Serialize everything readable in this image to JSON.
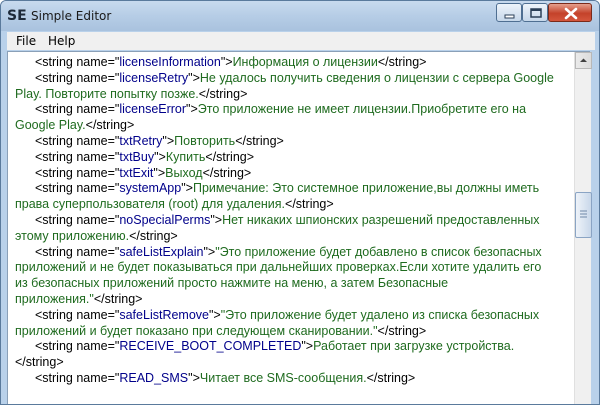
{
  "window": {
    "icon_text": "SE",
    "title": "Simple Editor"
  },
  "menu": {
    "file": "File",
    "help": "Help"
  },
  "editor": {
    "lines": [
      {
        "indent": true,
        "pre": "<string name=\"",
        "key": "licenseInformation",
        "mid": "\">",
        "val": "Информация о лицензии",
        "post": "</string>"
      },
      {
        "indent": true,
        "pre": "<string name=\"",
        "key": "licenseRetry",
        "mid": "\">",
        "val": "Не удалось получить сведения о лицензии с сервера Google",
        "post": ""
      },
      {
        "indent": false,
        "pre": "",
        "key": "",
        "mid": "",
        "val": "Play. Повторите попытку позже.",
        "post": "</string>"
      },
      {
        "indent": true,
        "pre": "<string name=\"",
        "key": "licenseError",
        "mid": "\">",
        "val": "Это приложение не имеет лицензии.Приобретите его на",
        "post": ""
      },
      {
        "indent": false,
        "pre": "",
        "key": "",
        "mid": "",
        "val": "Google Play.",
        "post": "</string>"
      },
      {
        "indent": true,
        "pre": "<string name=\"",
        "key": "txtRetry",
        "mid": "\">",
        "val": "Повторить",
        "post": "</string>"
      },
      {
        "indent": true,
        "pre": "<string name=\"",
        "key": "txtBuy",
        "mid": "\">",
        "val": "Купить",
        "post": "</string>"
      },
      {
        "indent": true,
        "pre": "<string name=\"",
        "key": "txtExit",
        "mid": "\">",
        "val": "Выход",
        "post": "</string>"
      },
      {
        "indent": true,
        "pre": "<string name=\"",
        "key": "systemApp",
        "mid": "\">",
        "val": "Примечание: Это системное приложение,вы должны иметь",
        "post": ""
      },
      {
        "indent": false,
        "pre": "",
        "key": "",
        "mid": "",
        "val": "права суперпользователя (root) для удаления.",
        "post": "</string>"
      },
      {
        "indent": true,
        "pre": "<string name=\"",
        "key": "noSpecialPerms",
        "mid": "\">",
        "val": "Нет никаких шпионских разрешений предоставленных",
        "post": ""
      },
      {
        "indent": false,
        "pre": "",
        "key": "",
        "mid": "",
        "val": "этому приложению.",
        "post": "</string>"
      },
      {
        "indent": true,
        "pre": "<string name=\"",
        "key": "safeListExplain",
        "mid": "\">",
        "val": "\"Это приложение будет добавлено в список безопасных",
        "post": ""
      },
      {
        "indent": false,
        "pre": "",
        "key": "",
        "mid": "",
        "val": "приложений и не будет показываться при дальнейших проверках.Если хотите удалить его",
        "post": ""
      },
      {
        "indent": false,
        "pre": "",
        "key": "",
        "mid": "",
        "val": "из безопасных приложений просто нажмите на меню, а затем Безопасные",
        "post": ""
      },
      {
        "indent": false,
        "pre": "",
        "key": "",
        "mid": "",
        "val": "приложения.\"",
        "post": "</string>"
      },
      {
        "indent": true,
        "pre": "<string name=\"",
        "key": "safeListRemove",
        "mid": "\">",
        "val": "\"Это приложение будет удалено из списка безопасных",
        "post": ""
      },
      {
        "indent": false,
        "pre": "",
        "key": "",
        "mid": "",
        "val": "приложений и будет показано при следующем сканировании.\"",
        "post": "</string>"
      },
      {
        "indent": true,
        "pre": "<string name=\"",
        "key": "RECEIVE_BOOT_COMPLETED",
        "mid": "\">",
        "val": "Работает при загрузке устройства.",
        "post": ""
      },
      {
        "indent": false,
        "pre": "",
        "key": "",
        "mid": "",
        "val": "",
        "post": "</string>"
      },
      {
        "indent": true,
        "pre": "<string name=\"",
        "key": "READ_SMS",
        "mid": "\">",
        "val": "Читает все SMS-сообщения.",
        "post": "</string>"
      }
    ]
  },
  "scrollbar": {
    "position_fraction": 0.42
  }
}
